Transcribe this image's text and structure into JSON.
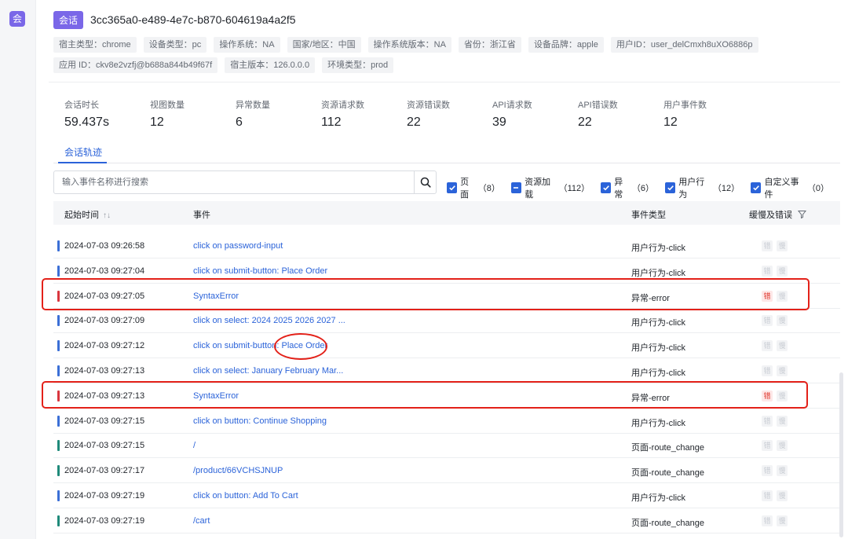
{
  "app": {
    "badge": "会"
  },
  "session": {
    "badge": "会话",
    "id": "3cc365a0-e489-4e7c-b870-604619a4a2f5"
  },
  "tags": [
    "宿主类型：chrome",
    "设备类型：pc",
    "操作系统：NA",
    "国家/地区：中国",
    "操作系统版本：NA",
    "省份：浙江省",
    "设备品牌：apple",
    "用户ID：user_delCmxh8uXO6886p",
    "应用 ID：ckv8e2vzfj@b688a844b49f67f",
    "宿主版本：126.0.0.0",
    "环境类型：prod"
  ],
  "stats": [
    {
      "label": "会话时长",
      "value": "59.437s"
    },
    {
      "label": "视图数量",
      "value": "12"
    },
    {
      "label": "异常数量",
      "value": "6"
    },
    {
      "label": "资源请求数",
      "value": "112"
    },
    {
      "label": "资源错误数",
      "value": "22"
    },
    {
      "label": "API请求数",
      "value": "39"
    },
    {
      "label": "API错误数",
      "value": "22"
    },
    {
      "label": "用户事件数",
      "value": "12"
    }
  ],
  "tabs": {
    "active": "会话轨迹"
  },
  "search": {
    "placeholder": "输入事件名称进行搜索",
    "value": ""
  },
  "filters": [
    {
      "label": "页面",
      "count": "（8）",
      "state": "checked"
    },
    {
      "label": "资源加载",
      "count": "（112）",
      "state": "indeterminate"
    },
    {
      "label": "异常",
      "count": "（6）",
      "state": "checked"
    },
    {
      "label": "用户行为",
      "count": "（12）",
      "state": "checked"
    },
    {
      "label": "自定义事件",
      "count": "（0）",
      "state": "checked"
    }
  ],
  "table": {
    "headers": {
      "time": "起始时间",
      "event": "事件",
      "type": "事件类型",
      "flags": "缓慢及错误"
    },
    "chip_labels": {
      "error": "错",
      "slow": "慢"
    },
    "colors": {
      "action": "#3b6fd6",
      "error": "#d9363e",
      "page": "#1f8a7a"
    },
    "rows": [
      {
        "time": "2024-07-03 09:26:58",
        "event": "click on password-input",
        "type": "用户行为-click",
        "kind": "action",
        "error": false
      },
      {
        "time": "2024-07-03 09:27:04",
        "event": "click on submit-button: Place Order",
        "type": "用户行为-click",
        "kind": "action",
        "error": false
      },
      {
        "time": "2024-07-03 09:27:05",
        "event": "SyntaxError",
        "type": "异常-error",
        "kind": "error",
        "error": true
      },
      {
        "time": "2024-07-03 09:27:09",
        "event": "click on select: 2024 2025 2026 2027 ...",
        "type": "用户行为-click",
        "kind": "action",
        "error": false
      },
      {
        "time": "2024-07-03 09:27:12",
        "event": "click on submit-button: Place Order",
        "type": "用户行为-click",
        "kind": "action",
        "error": false
      },
      {
        "time": "2024-07-03 09:27:13",
        "event": "click on select: January February Mar...",
        "type": "用户行为-click",
        "kind": "action",
        "error": false
      },
      {
        "time": "2024-07-03 09:27:13",
        "event": "SyntaxError",
        "type": "异常-error",
        "kind": "error",
        "error": true
      },
      {
        "time": "2024-07-03 09:27:15",
        "event": "click on button: Continue Shopping",
        "type": "用户行为-click",
        "kind": "action",
        "error": false
      },
      {
        "time": "2024-07-03 09:27:15",
        "event": "/",
        "type": "页面-route_change",
        "kind": "page",
        "error": false
      },
      {
        "time": "2024-07-03 09:27:17",
        "event": "/product/66VCHSJNUP",
        "type": "页面-route_change",
        "kind": "page",
        "error": false
      },
      {
        "time": "2024-07-03 09:27:19",
        "event": "click on button: Add To Cart",
        "type": "用户行为-click",
        "kind": "action",
        "error": false
      },
      {
        "time": "2024-07-03 09:27:19",
        "event": "/cart",
        "type": "页面-route_change",
        "kind": "page",
        "error": false
      }
    ]
  }
}
